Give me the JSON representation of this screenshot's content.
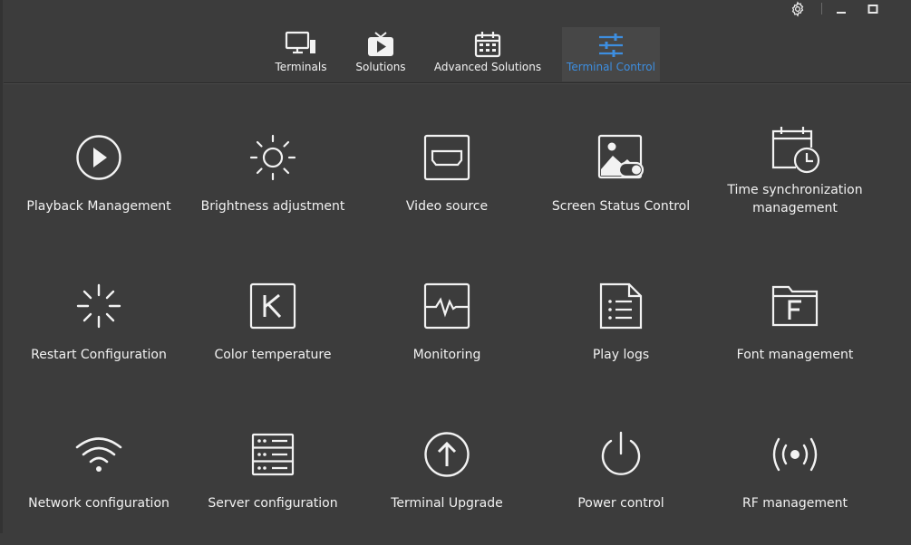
{
  "window_controls": {
    "settings": "gear-icon",
    "minimize": "minimize-icon",
    "maximize": "maximize-icon"
  },
  "nav": {
    "tabs": [
      {
        "label": "Terminals",
        "icon": "monitor-icon"
      },
      {
        "label": "Solutions",
        "icon": "play-tv-icon"
      },
      {
        "label": "Advanced Solutions",
        "icon": "calendar-icon"
      },
      {
        "label": "Terminal Control",
        "icon": "sliders-icon",
        "active": true
      }
    ],
    "active_color": "#3d8ee0"
  },
  "tiles": [
    {
      "label": "Playback Management",
      "icon": "play-circle-icon"
    },
    {
      "label": "Brightness adjustment",
      "icon": "sun-icon"
    },
    {
      "label": "Video source",
      "icon": "hdmi-icon"
    },
    {
      "label": "Screen Status Control",
      "icon": "image-toggle-icon"
    },
    {
      "label": "Time synchronization\nmanagement",
      "icon": "calendar-clock-icon"
    },
    {
      "label": "Restart Configuration",
      "icon": "loading-spinner-icon"
    },
    {
      "label": "Color temperature",
      "icon": "k-box-icon"
    },
    {
      "label": "Monitoring",
      "icon": "pulse-monitor-icon"
    },
    {
      "label": "Play logs",
      "icon": "document-list-icon"
    },
    {
      "label": "Font management",
      "icon": "font-folder-icon"
    },
    {
      "label": "Network configuration",
      "icon": "wifi-icon"
    },
    {
      "label": "Server configuration",
      "icon": "server-icon"
    },
    {
      "label": "Terminal Upgrade",
      "icon": "upload-circle-icon"
    },
    {
      "label": "Power control",
      "icon": "power-icon"
    },
    {
      "label": "RF management",
      "icon": "broadcast-icon"
    }
  ]
}
